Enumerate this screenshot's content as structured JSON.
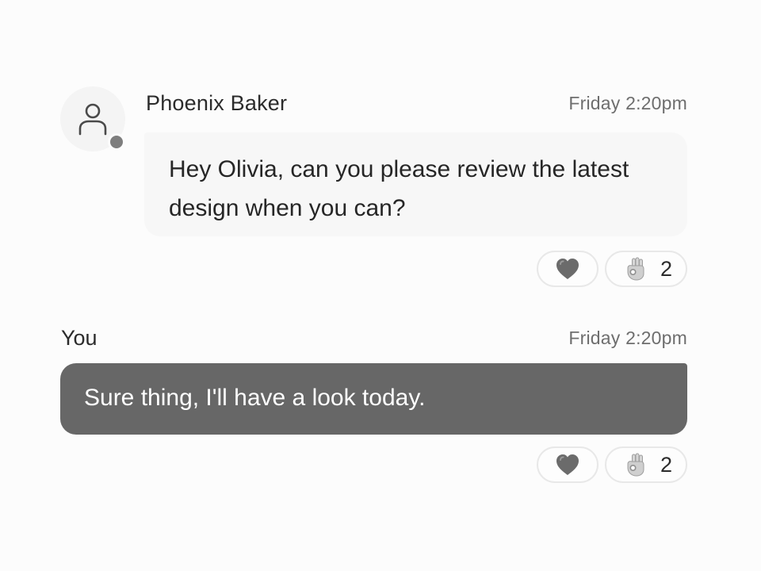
{
  "messages": [
    {
      "sender": "Phoenix Baker",
      "time": "Friday 2:20pm",
      "text": "Hey Olivia, can you please review the latest design when you can?",
      "avatar_icon": "user-icon",
      "online_status": "online",
      "reactions": [
        {
          "icon": "heart-icon",
          "emoji": "heart"
        },
        {
          "icon": "ok-hand-icon",
          "emoji": "ok-hand",
          "count": "2"
        }
      ]
    },
    {
      "sender": "You",
      "time": "Friday 2:20pm",
      "text": "Sure thing, I'll have a look today.",
      "reactions": [
        {
          "icon": "heart-icon",
          "emoji": "heart"
        },
        {
          "icon": "ok-hand-icon",
          "emoji": "ok-hand",
          "count": "2"
        }
      ]
    }
  ],
  "colors": {
    "incoming_bubble": "#f7f7f7",
    "outgoing_bubble": "#676767",
    "presence_dot": "#7e7e7e"
  }
}
